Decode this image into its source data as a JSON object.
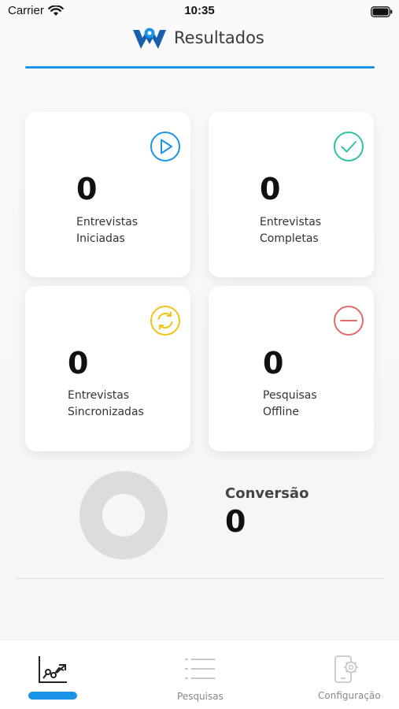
{
  "status_bar": {
    "carrier": "Carrier",
    "time": "10:35"
  },
  "header": {
    "title": "Resultados",
    "accent_color": "#1a93e8"
  },
  "cards": [
    {
      "value": "0",
      "label_line1": "Entrevistas",
      "label_line2": "Iniciadas",
      "icon": "play-circle-icon",
      "icon_color": "#1a93e8"
    },
    {
      "value": "0",
      "label_line1": "Entrevistas",
      "label_line2": "Completas",
      "icon": "check-circle-icon",
      "icon_color": "#2ec4a0"
    },
    {
      "value": "0",
      "label_line1": "Entrevistas",
      "label_line2": "Sincronizadas",
      "icon": "sync-circle-icon",
      "icon_color": "#f2c315"
    },
    {
      "value": "0",
      "label_line1": "Pesquisas",
      "label_line2": "Offline",
      "icon": "minus-circle-icon",
      "icon_color": "#e06b6b"
    }
  ],
  "conversion": {
    "title": "Conversão",
    "value": "0"
  },
  "tab_bar": {
    "tabs": [
      {
        "label": "",
        "icon": "chart-icon",
        "active": true
      },
      {
        "label": "Pesquisas",
        "icon": "list-icon",
        "active": false
      },
      {
        "label": "Configuração",
        "icon": "device-settings-icon",
        "active": false
      }
    ]
  }
}
